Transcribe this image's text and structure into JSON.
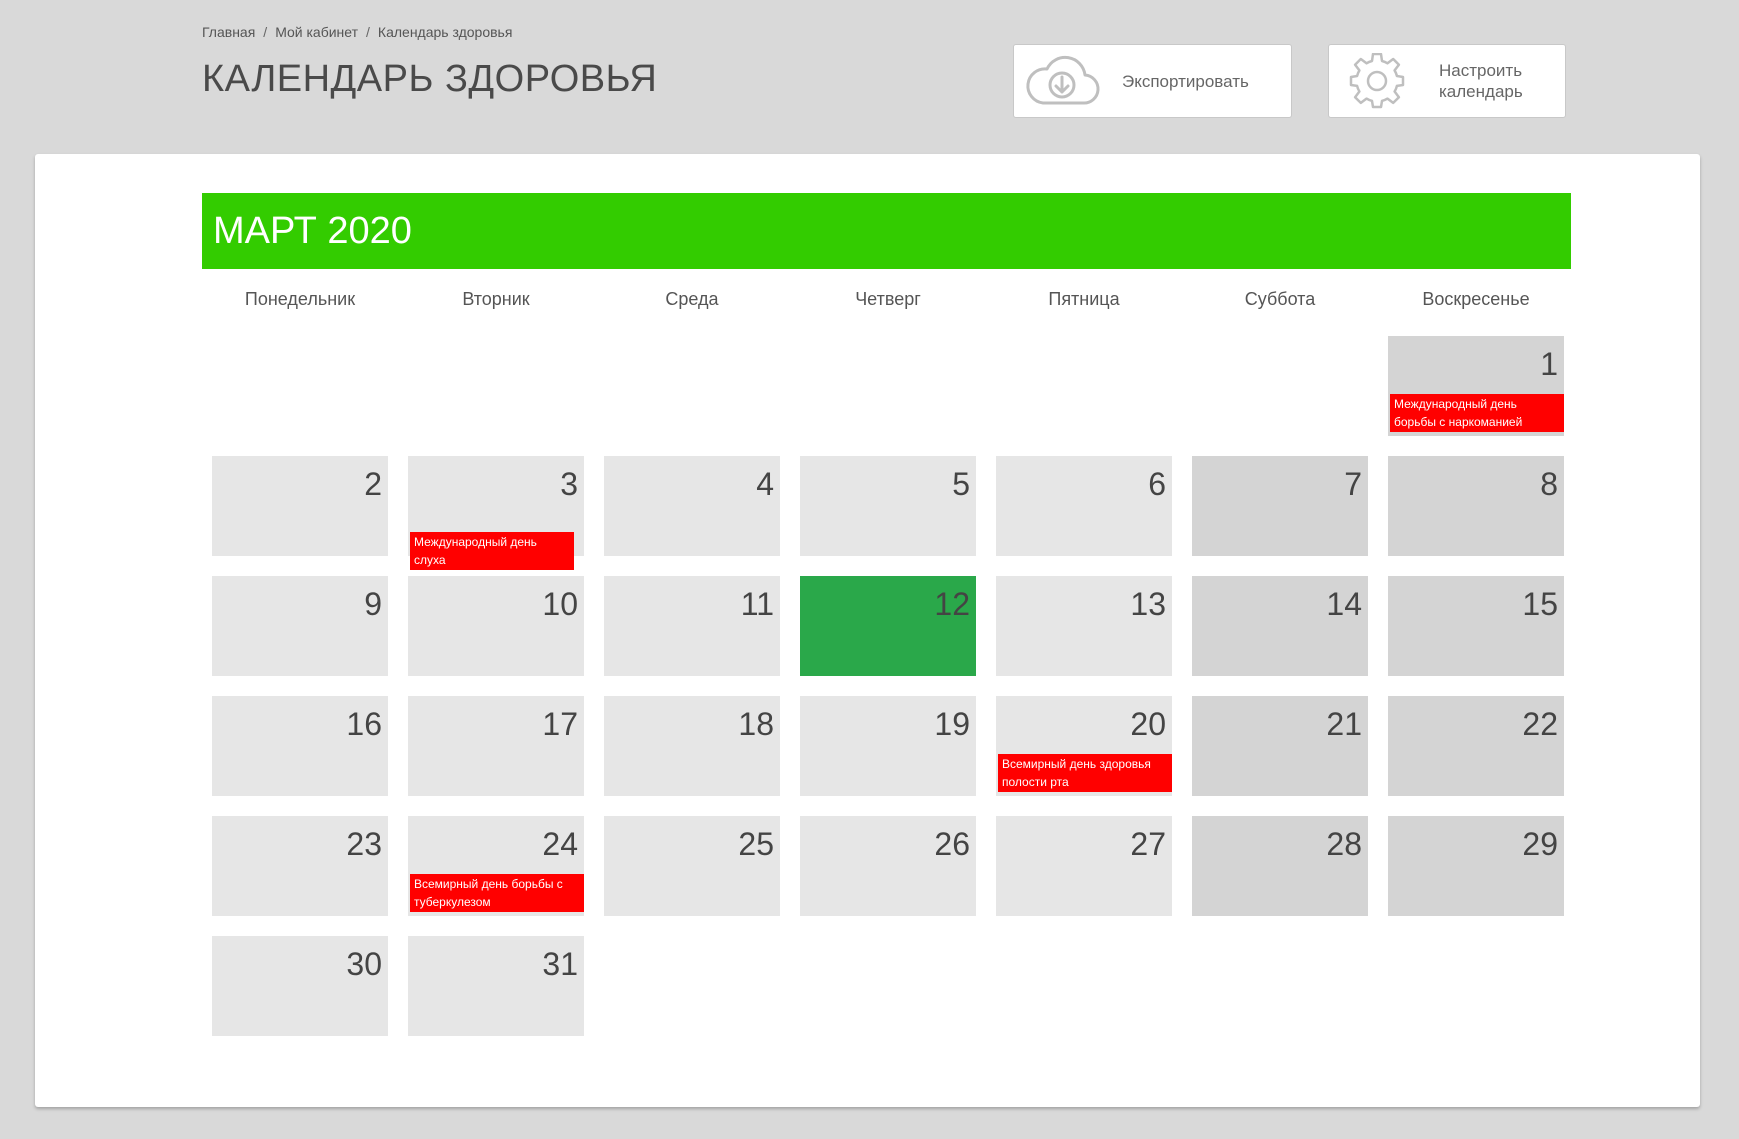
{
  "breadcrumb": {
    "items": [
      "Главная",
      "Мой кабинет",
      "Календарь здоровья"
    ],
    "separator": "/"
  },
  "page_title": "КАЛЕНДАРЬ ЗДОРОВЬЯ",
  "toolbar": {
    "export_label": "Экспортировать",
    "settings_label": "Настроить\nкалендарь",
    "export_icon": "cloud-download-icon",
    "settings_icon": "gear-icon"
  },
  "calendar": {
    "month_title": "МАРТ 2020",
    "header_color": "#33cc00",
    "today_color": "#2aa84a",
    "event_color": "#ff0000",
    "weekdays": [
      "Понедельник",
      "Вторник",
      "Среда",
      "Четверг",
      "Пятница",
      "Суббота",
      "Воскресенье"
    ],
    "start_weekday_index": 6,
    "days_in_month": 31,
    "today": 12,
    "events": [
      {
        "day": 1,
        "text": "Международный день борьбы с наркоманией"
      },
      {
        "day": 3,
        "text": "Международный день слуха"
      },
      {
        "day": 20,
        "text": "Всемирный день здоровья полости рта"
      },
      {
        "day": 24,
        "text": "Всемирный день борьбы с туберкулезом"
      }
    ]
  }
}
